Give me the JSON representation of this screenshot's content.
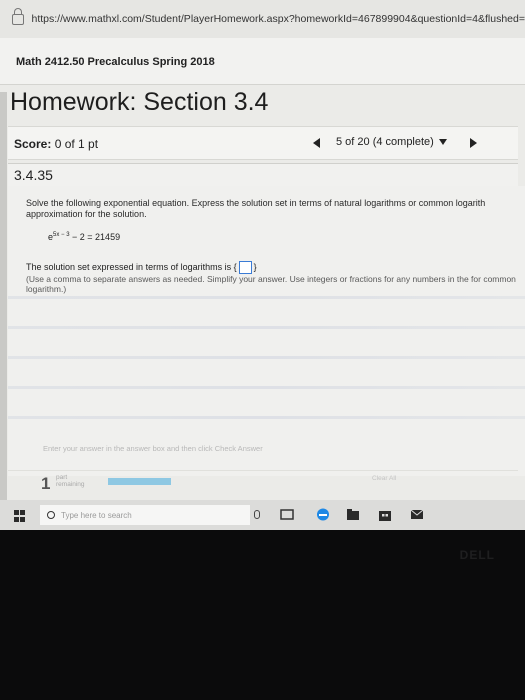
{
  "browser": {
    "url": "https://www.mathxl.com/Student/PlayerHomework.aspx?homeworkId=467899904&questionId=4&flushed="
  },
  "course": {
    "title": "Math 2412.50 Precalculus Spring 2018"
  },
  "homework": {
    "title": "Homework: Section 3.4",
    "score_label": "Score:",
    "score_value": "0 of 1 pt",
    "progress": "5 of 20 (4 complete)"
  },
  "question": {
    "id": "3.4.35",
    "instruction": "Solve the following exponential equation. Express the solution set in terms of natural logarithms or common logarith approximation for the solution.",
    "equation_base": "e",
    "equation_exponent": "5x − 3",
    "equation_rest": " − 2 = 21459",
    "solution_prefix": "The solution set expressed in terms of logarithms is",
    "brace_open": "{",
    "brace_close": "}",
    "hint": "(Use a comma to separate answers as needed. Simplify your answer. Use integers or fractions for any numbers in the for common logarithm.)"
  },
  "footer": {
    "enter_text": "Enter your answer in the answer box and then click Check Answer",
    "parts_number": "1",
    "parts_label_1": "part",
    "parts_label_2": "remaining",
    "parts_progress": 0.35,
    "clear_all": "Clear All"
  },
  "taskbar": {
    "search_placeholder": "Type here to search",
    "colors": {
      "edge": "#1e88e5",
      "store": "#2a2a2a",
      "mail": "#2a2a2a"
    }
  },
  "hardware": {
    "brand": "DELL"
  }
}
